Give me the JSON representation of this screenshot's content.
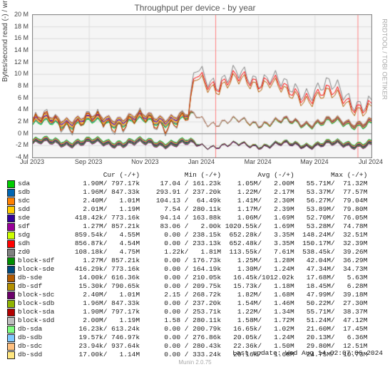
{
  "title": "Throughput per device - by year",
  "ylabel": "Bytes/second read (-) / write (+)",
  "watermark": "RRDTOOL / TOBI OETIKER",
  "footer": "Munin 2.0.75",
  "last_update": "Last update: Wed Aug 14 02:07:06 2024",
  "chart_data": {
    "type": "line",
    "ylim": [
      -4,
      20
    ],
    "ytick_step": 2,
    "ytick_suffix": " M",
    "xticks": [
      "Jul 2023",
      "Sep 2023",
      "Nov 2023",
      "Jan 2024",
      "Mar 2024",
      "May 2024",
      "Jul 2024"
    ]
  },
  "legend_header": {
    "name": "",
    "cur": "Cur (-/+)",
    "min": "Min (-/+)",
    "avg": "Avg (-/+)",
    "max": "Max (-/+)"
  },
  "legend": [
    {
      "color": "#00cc00",
      "name": "sda",
      "cur": "1.90M/ 797.17k",
      "min": "17.04 / 161.23k",
      "avg": "1.05M/",
      "avg2": "2.00M",
      "max": "55.71M/  71.32M"
    },
    {
      "color": "#0066b3",
      "name": "sdb",
      "cur": "1.96M/ 847.33k",
      "min": "293.91 / 237.20k",
      "avg": "1.22M/",
      "avg2": "2.17M",
      "max": "53.37M/  77.57M"
    },
    {
      "color": "#ff8000",
      "name": "sdc",
      "cur": "2.40M/",
      "cur2": "1.01M",
      "min": "104.13 /  64.49k",
      "avg": "1.41M/",
      "avg2": "2.30M",
      "max": "56.27M/  79.04M"
    },
    {
      "color": "#ffcc00",
      "name": "sdd",
      "cur": "2.01M/",
      "cur2": "1.19M",
      "min": "7.54 / 280.11k",
      "avg": "1.17M/",
      "avg2": "2.39M",
      "max": "53.89M/  79.80M"
    },
    {
      "color": "#330099",
      "name": "sde",
      "cur": "418.42k/ 773.16k",
      "min": "94.14 / 163.88k",
      "avg": "1.06M/",
      "avg2": "1.69M",
      "max": "52.70M/  76.05M"
    },
    {
      "color": "#990099",
      "name": "sdf",
      "cur": "1.27M/ 857.21k",
      "min": "83.06 /",
      "min2": "2.00k",
      "avg": "1020.55k/",
      "avg2": "1.69M",
      "max": "53.28M/  74.78M"
    },
    {
      "color": "#ccff00",
      "name": "sdg",
      "cur": "859.54k/",
      "cur2": "4.55M",
      "min": "0.00 / 238.15k",
      "avg": "652.28k/",
      "avg2": "3.35M",
      "max": "148.24M/  32.51M"
    },
    {
      "color": "#ff0000",
      "name": "sdh",
      "cur": "856.87k/",
      "cur2": "4.54M",
      "min": "0.00 / 233.13k",
      "avg": "652.48k/",
      "avg2": "3.35M",
      "max": "150.17M/  32.39M"
    },
    {
      "color": "#808080",
      "name": "zd0",
      "cur": "108.18k/",
      "cur2": "4.75M",
      "min": "1.22k/",
      "min2": "1.81M",
      "avg": "113.55k/",
      "avg2": "7.61M",
      "max": "538.45k/  39.26M"
    },
    {
      "color": "#008f00",
      "name": "block-sdf",
      "cur": "1.27M/ 857.21k",
      "min": "0.00 / 176.73k",
      "avg": "1.25M/",
      "avg2": "1.28M",
      "max": "42.04M/  36.29M"
    },
    {
      "color": "#00487d",
      "name": "block-sde",
      "cur": "416.29k/ 773.16k",
      "min": "0.00 / 164.19k",
      "avg": "1.30M/",
      "avg2": "1.24M",
      "max": "47.34M/  34.73M"
    },
    {
      "color": "#b35a00",
      "name": "db-sde",
      "cur": "14.00k/ 616.36k",
      "min": "0.00 / 210.05k",
      "avg": "16.45k/1012.02k",
      "avg2": "",
      "max": "17.68M/   5.63M"
    },
    {
      "color": "#b38f00",
      "name": "db-sdf",
      "cur": "15.30k/ 790.65k",
      "min": "0.00 / 209.75k",
      "avg": "15.73k/",
      "avg2": "1.18M",
      "max": "18.45M/   6.28M"
    },
    {
      "color": "#6b006b",
      "name": "block-sdc",
      "cur": "2.40M/",
      "cur2": "1.01M",
      "min": "2.15 / 268.72k",
      "avg": "1.82M/",
      "avg2": "1.68M",
      "max": "47.99M/  39.18M"
    },
    {
      "color": "#8fb300",
      "name": "block-sdb",
      "cur": "1.96M/ 847.33k",
      "min": "0.00 / 237.20k",
      "avg": "1.54M/",
      "avg2": "1.46M",
      "max": "50.22M/  27.30M"
    },
    {
      "color": "#b30000",
      "name": "block-sda",
      "cur": "1.90M/ 797.17k",
      "min": "0.00 / 253.71k",
      "avg": "1.22M/",
      "avg2": "1.34M",
      "max": "55.71M/  38.37M"
    },
    {
      "color": "#bebebe",
      "name": "block-sdd",
      "cur": "2.00M/",
      "cur2": "1.19M",
      "min": "1.58 / 280.11k",
      "avg": "1.58M/",
      "avg2": "1.72M",
      "max": "51.24M/  47.12M"
    },
    {
      "color": "#80ff80",
      "name": "db-sda",
      "cur": "16.23k/ 613.24k",
      "min": "0.00 / 200.79k",
      "avg": "16.65k/",
      "avg2": "1.02M",
      "max": "21.60M/  17.45M"
    },
    {
      "color": "#80c9ff",
      "name": "db-sdb",
      "cur": "19.57k/ 746.97k",
      "min": "0.00 / 276.86k",
      "avg": "20.05k/",
      "avg2": "1.24M",
      "max": "20.13M/   6.36M"
    },
    {
      "color": "#ffc080",
      "name": "db-sdc",
      "cur": "23.94k/ 937.64k",
      "min": "0.00 / 280.43k",
      "avg": "22.36k/",
      "avg2": "1.50M",
      "max": "29.80M/  12.51M"
    },
    {
      "color": "#ffe680",
      "name": "db-sdd",
      "cur": "17.00k/",
      "cur2": "1.14M",
      "min": "0.00 / 333.24k",
      "avg": "20.16k/",
      "avg2": "1.68M",
      "max": "24.75M/  10.73M"
    }
  ]
}
